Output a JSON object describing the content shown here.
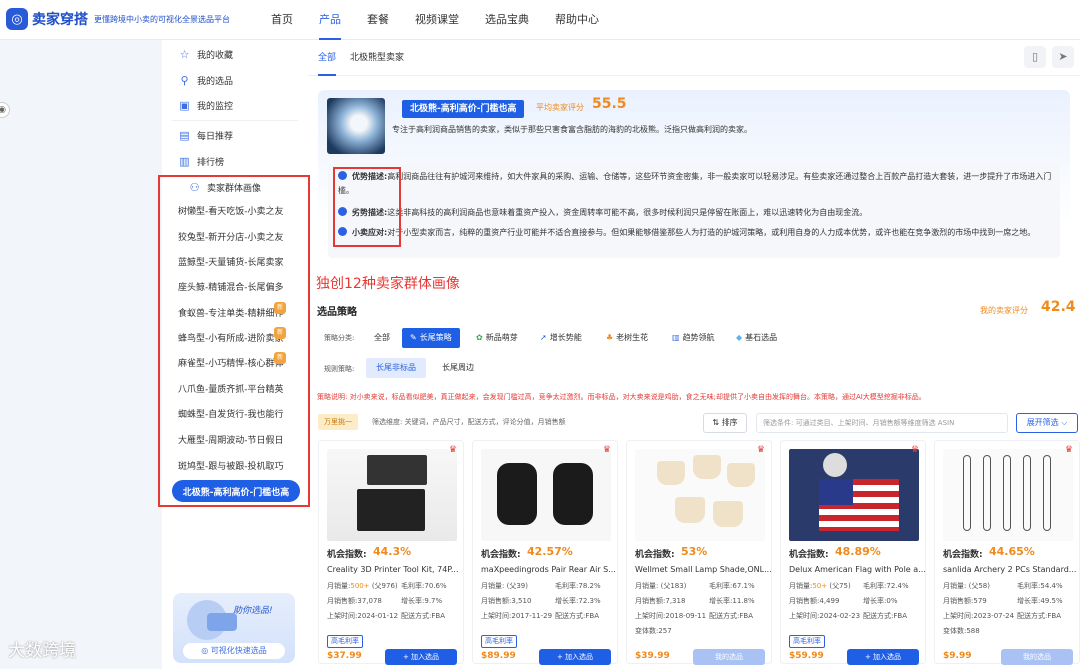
{
  "brand": {
    "name": "卖家穿搭",
    "slogan": "更懂跨境中小卖的可视化全景选品平台"
  },
  "nav": [
    "首页",
    "产品",
    "套餐",
    "视频课堂",
    "选品宝典",
    "帮助中心"
  ],
  "sidebar": {
    "top_items": [
      "我的收藏",
      "我的选品",
      "我的监控"
    ],
    "mid_items": [
      "每日推荐",
      "排行榜"
    ],
    "persona_header": "卖家群体画像",
    "personas": [
      "树懒型-看天吃饭-小卖之友",
      "狡兔型-新开分店-小卖之友",
      "蓝鲸型-天量铺货-长尾卖家",
      "座头鲸-精铺混合-长尾偏多",
      "食蚁兽-专注单类-精耕细作",
      "蜂鸟型-小有所成-进阶卖家",
      "麻雀型-小巧精悍-核心群体",
      "八爪鱼-量质齐抓-平台精英",
      "蜘蛛型-自发货行-我也能行",
      "大雁型-周期波动-节日假日",
      "斑鸠型-跟与被跟-投机取巧",
      "北极熊-高利高价-门槛也高"
    ],
    "new_badge": "新",
    "ad_text": "助你选品!",
    "ad_button": "◎ 可视化快速选品"
  },
  "annotation": "独创12种卖家群体画像",
  "tabs": [
    "全部",
    "北极熊型卖家"
  ],
  "persona": {
    "name": "北极熊-高利高价-门槛也高",
    "score_label": "平均卖家评分",
    "score": "55.5",
    "desc": "专注于高利润商品销售的卖家，类似于那些只害食富含脂肪的海豹的北极熊。泛指只做高利润的卖家。",
    "adv_label": "优势描述:",
    "adv": "高利润商品往往有护城河来维持，如大件家具的采购、运输、仓储等，这些环节资金密集，非一般卖家可以轻易涉足。有些卖家还通过整合上百款产品打造大套装，进一步提升了市场进入门槛。",
    "dis_label": "劣势描述:",
    "dis": "这类非高科技的高利润商品也意味着重资产投入，资金周转率可能不高，很多时候利润只是停留在账面上，难以迅速转化为自由现金流。",
    "small_label": "小卖应对:",
    "small": "对于小型卖家而言，纯粹的重资产行业可能并不适合直接参与。但如果能够借鉴那些人为打造的护城河策略，或利用自身的人力成本优势，或许也能在竞争激烈的市场中找到一席之地。"
  },
  "strategy": {
    "title": "选品策略",
    "my_score_label": "我的卖家评分",
    "my_score": "42.4",
    "cat_label": "策略分类:",
    "categories": [
      "全部",
      "长尾策略",
      "新品萌芽",
      "增长势能",
      "老树生花",
      "趋势领航",
      "基石选品"
    ],
    "rule_label": "规则策略:",
    "rules": [
      "长尾非标品",
      "长尾周边"
    ],
    "hint": "策略说明: 对小卖来说，标品看似肥美，真正做起来，会发现门槛过高，竞争太过激烈。而非标品，对大卖来说是鸡肋，食之无味;却提供了小卖自由发挥的舞台。本策略，通过AI大模型挖掘非标品。",
    "hot_badge": "万里挑一",
    "dim_label": "筛选维度: 关键词，产品尺寸，配送方式，评论分值，月销售额",
    "sort_label": "⇅ 排序",
    "search_placeholder": "筛选条件: 可通过类目、上架时间、月销售额等维度筛选 ASIN",
    "expand_label": "展开筛选 ⌵"
  },
  "products": [
    {
      "opp_label": "机会指数:",
      "opp": "44.3%",
      "title": "Creality 3D Printer Tool Kit, 74P...",
      "sales": "500+",
      "parent": "(父976)",
      "margin": "70.6%",
      "revenue": "37,078",
      "growth": "9.7%",
      "date": "2024-01-12",
      "ship": "FBA",
      "vartype": "",
      "tag": "高毛利率",
      "price": "$37.99",
      "btn": "+ 加入选品",
      "btn_disabled": false
    },
    {
      "opp_label": "机会指数:",
      "opp": "42.57%",
      "title": "maXpeedingrods Pair Rear Air S...",
      "sales": "",
      "parent": "(父39)",
      "margin": "78.2%",
      "revenue": "3,510",
      "growth": "72.3%",
      "date": "2017-11-29",
      "ship": "FBA",
      "vartype": "",
      "tag": "高毛利率",
      "price": "$89.99",
      "btn": "+ 加入选品",
      "btn_disabled": false
    },
    {
      "opp_label": "机会指数:",
      "opp": "53%",
      "title": "Wellmet Small Lamp Shade,ONL...",
      "sales": "",
      "parent": "(父183)",
      "margin": "67.1%",
      "revenue": "7,318",
      "growth": "11.8%",
      "date": "2018-09-11",
      "ship": "FBA",
      "vartype": "变体数:257",
      "tag": "",
      "price": "$39.99",
      "btn": "我的选品",
      "btn_disabled": true
    },
    {
      "opp_label": "机会指数:",
      "opp": "48.89%",
      "title": "Delux American Flag with Pole a...",
      "sales": "50+",
      "parent": "(父75)",
      "margin": "72.4%",
      "revenue": "4,499",
      "growth": "0%",
      "date": "2024-02-23",
      "ship": "FBA",
      "vartype": "",
      "tag": "高毛利率",
      "price": "$59.99",
      "btn": "+ 加入选品",
      "btn_disabled": false
    },
    {
      "opp_label": "机会指数:",
      "opp": "44.65%",
      "title": "sanlida Archery 2 PCs Standard...",
      "sales": "",
      "parent": "(父58)",
      "margin": "54.4%",
      "revenue": "579",
      "growth": "49.5%",
      "date": "2023-07-24",
      "ship": "FBA",
      "vartype": "变体数:588",
      "tag": "",
      "price": "$9.99",
      "btn": "我的选品",
      "btn_disabled": true
    }
  ],
  "labels": {
    "sales": "月销量:",
    "margin": "毛利率:",
    "revenue": "月销售额:",
    "growth": "增长率:",
    "date": "上架时间:",
    "ship": "配送方式:"
  },
  "watermark": "大数跨境"
}
